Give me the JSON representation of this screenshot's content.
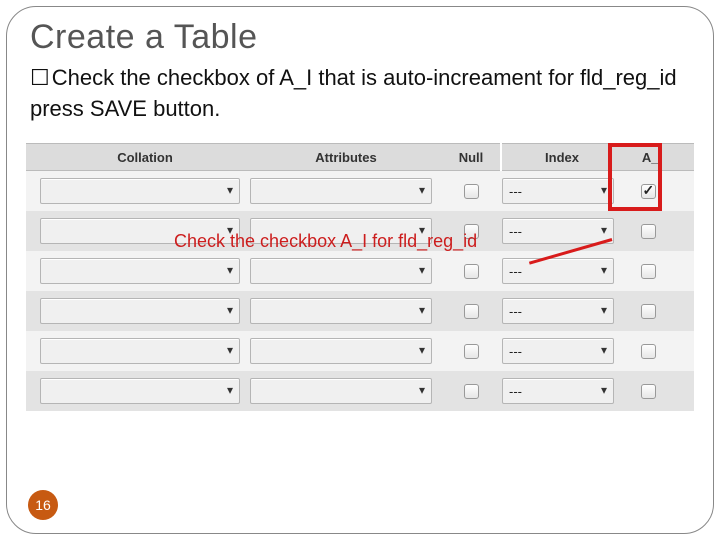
{
  "title": "Create a Table",
  "bullet": "Check the checkbox of A_I that is auto-increament for fld_reg_id press SAVE button.",
  "headers": {
    "collation": "Collation",
    "attributes": "Attributes",
    "null": "Null",
    "index": "Index",
    "ai": "A_I"
  },
  "rows": [
    {
      "index_value": "---",
      "ai_checked": true
    },
    {
      "index_value": "---",
      "ai_checked": false
    },
    {
      "index_value": "---",
      "ai_checked": false
    },
    {
      "index_value": "---",
      "ai_checked": false
    },
    {
      "index_value": "---",
      "ai_checked": false
    },
    {
      "index_value": "---",
      "ai_checked": false
    }
  ],
  "callout": "Check the checkbox A_I for fld_reg_id",
  "page_number": "16"
}
